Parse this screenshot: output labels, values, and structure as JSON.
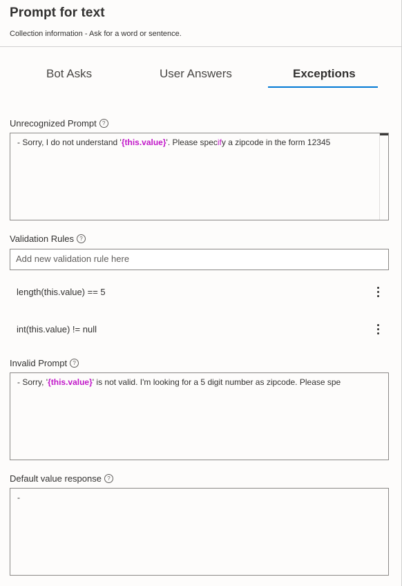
{
  "header": {
    "title": "Prompt for text",
    "subtitle": "Collection information - Ask for a word or sentence."
  },
  "tabs": [
    {
      "label": "Bot Asks",
      "active": false
    },
    {
      "label": "User Answers",
      "active": false
    },
    {
      "label": "Exceptions",
      "active": true
    }
  ],
  "unrecognized": {
    "label": "Unrecognized Prompt",
    "line_prefix": "- Sorry, I do not understand '",
    "var": "{this.value}",
    "line_mid": "'. Please spec",
    "line_hl": "if",
    "line_suffix": "y a zipcode in the form 12345"
  },
  "validation": {
    "label": "Validation Rules",
    "placeholder": "Add new validation rule here",
    "rules": [
      "length(this.value) == 5",
      "int(this.value) != null"
    ]
  },
  "invalid": {
    "label": "Invalid Prompt",
    "line_prefix": "- Sorry, '",
    "var": "{this.value}",
    "line_suffix": "' is not valid. I'm looking for a 5 digit number as zipcode. Please spe"
  },
  "default_value": {
    "label": "Default value response",
    "line": "-"
  },
  "colors": {
    "accent": "#0078d4",
    "variable": "#c117c9"
  }
}
